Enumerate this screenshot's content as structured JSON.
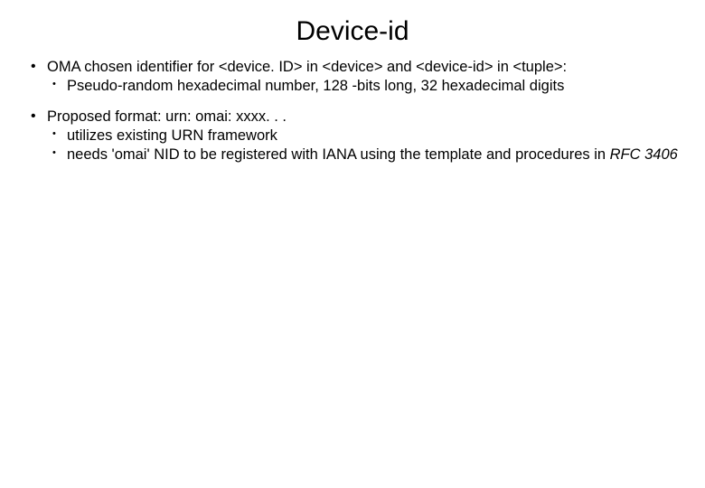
{
  "title": "Device-id",
  "bullets": [
    {
      "text": "OMA chosen identifier for <device. ID> in <device> and <device-id> in <tuple>:",
      "sub": [
        {
          "text": "Pseudo-random hexadecimal number, 128 -bits long, 32 hexadecimal digits"
        }
      ]
    },
    {
      "text": "Proposed format: urn: omai: xxxx. . .",
      "sub": [
        {
          "text": "utilizes existing URN framework"
        },
        {
          "text_pre": "needs 'omai' NID to be registered with IANA using the template and procedures in ",
          "text_em": "RFC 3406"
        }
      ]
    }
  ]
}
